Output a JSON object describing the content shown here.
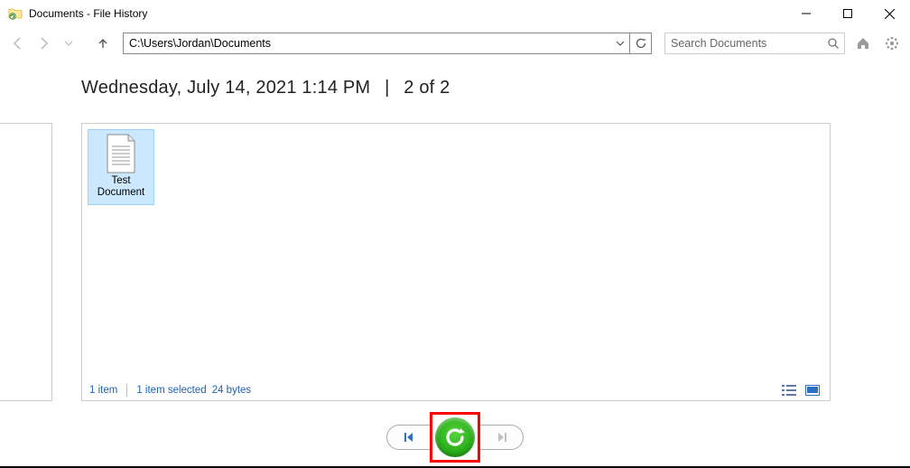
{
  "window": {
    "title": "Documents - File History"
  },
  "address": {
    "path": "C:\\Users\\Jordan\\Documents"
  },
  "search": {
    "placeholder": "Search Documents"
  },
  "header": {
    "date": "Wednesday, July 14, 2021 1:14 PM",
    "position": "2 of 2"
  },
  "files": [
    {
      "name": "Test Document",
      "selected": true
    }
  ],
  "status": {
    "count": "1 item",
    "selection": "1 item selected",
    "size": "24 bytes"
  }
}
